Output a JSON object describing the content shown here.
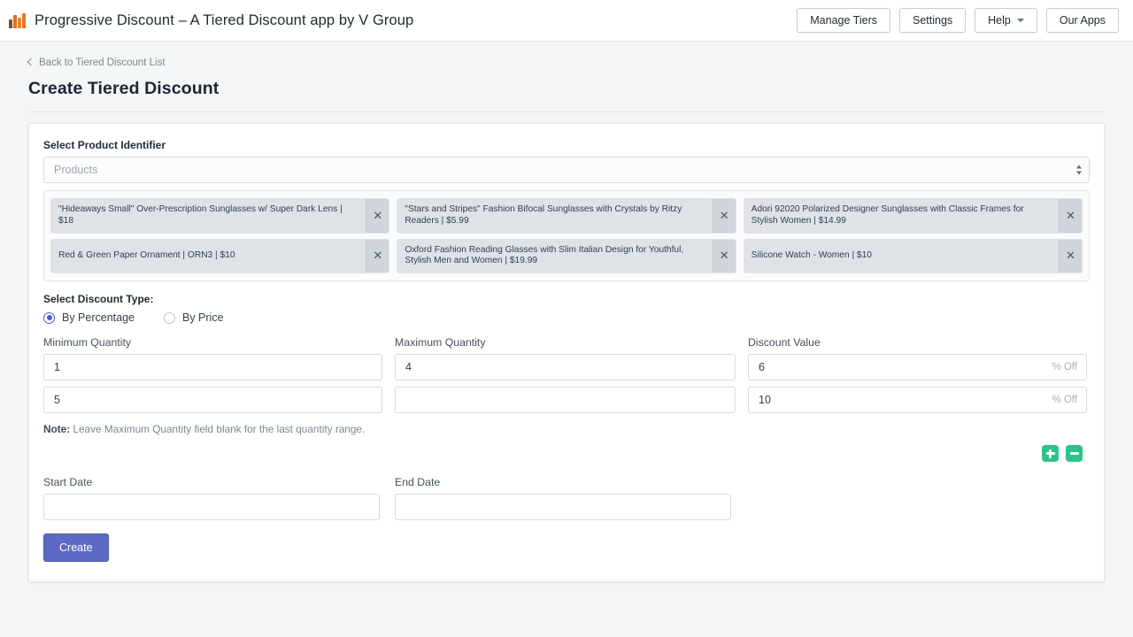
{
  "topbar": {
    "logo_icon": "bar-chart-logo-icon",
    "title": "Progressive Discount – A Tiered Discount app by V Group",
    "buttons": [
      {
        "label": "Manage Tiers"
      },
      {
        "label": "Settings"
      },
      {
        "label": "Help",
        "has_caret": true
      },
      {
        "label": "Our Apps"
      }
    ]
  },
  "page": {
    "back_link": "Back to Tiered Discount List",
    "back_icon": "chevron-left-icon",
    "title": "Create Tiered Discount"
  },
  "form": {
    "product_identifier_label": "Select Product Identifier",
    "product_select_placeholder": "Products",
    "select_stepper_icon": "updown-stepper-icon",
    "remove_icon": "close-x-icon",
    "selected_products": [
      "\"Hideaways Small\" Over-Prescription Sunglasses w/ Super Dark Lens | $18",
      "\"Stars and Stripes\" Fashion Bifocal Sunglasses with Crystals by Ritzy Readers | $5.99",
      "Adori 92020 Polarized Designer Sunglasses with Classic Frames for Stylish Women | $14.99",
      "Red & Green Paper Ornament | ORN3 | $10",
      "Oxford Fashion Reading Glasses with Slim Italian Design for Youthful, Stylish Men and Women | $19.99",
      "Silicone Watch - Women | $10"
    ],
    "discount_type_label": "Select Discount Type:",
    "discount_types": [
      {
        "label": "By Percentage",
        "selected": true
      },
      {
        "label": "By Price",
        "selected": false
      }
    ],
    "min_qty_label": "Minimum Quantity",
    "max_qty_label": "Maximum Quantity",
    "discount_value_label": "Discount Value",
    "tiers": [
      {
        "min": "1",
        "max": "4",
        "value": "6",
        "suffix": "% Off"
      },
      {
        "min": "5",
        "max": "",
        "value": "10",
        "suffix": "% Off"
      }
    ],
    "note_prefix": "Note:",
    "note_text": " Leave Maximum Quantity field blank for the last quantity range.",
    "add_row_icon": "plus-icon",
    "remove_row_icon": "minus-icon",
    "start_date_label": "Start Date",
    "end_date_label": "End Date",
    "start_date_value": "",
    "end_date_value": "",
    "submit_label": "Create"
  },
  "colors": {
    "primary": "#5c6ac4",
    "accent_green": "#2bc38a",
    "logo_orange": "#e8761f",
    "page_bg": "#f4f6f8"
  }
}
